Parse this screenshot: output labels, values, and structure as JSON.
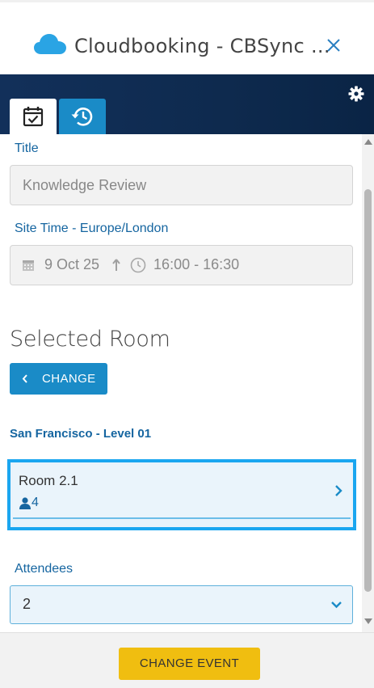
{
  "header": {
    "title": "Cloudbooking - CBSync ...",
    "logo_icon": "cloud-icon",
    "close_icon": "close-icon"
  },
  "toolbar": {
    "settings_icon": "gear-icon",
    "tabs": [
      {
        "icon": "calendar-check-icon",
        "active": true
      },
      {
        "icon": "history-icon",
        "active": false
      }
    ]
  },
  "form": {
    "title_label": "Title",
    "title_value": "Knowledge Review",
    "site_time_label": "Site Time - Europe/London",
    "date_value": "9 Oct 25",
    "time_value": "16:00 - 16:30",
    "selected_room_heading": "Selected Room",
    "change_button": "CHANGE",
    "floor_label": "San Francisco - Level 01",
    "room": {
      "name": "Room 2.1",
      "capacity": "4"
    },
    "attendees_label": "Attendees",
    "attendees_value": "2"
  },
  "footer": {
    "change_event_button": "CHANGE EVENT"
  },
  "colors": {
    "banner": "#0e2a4e",
    "accent_blue": "#1a8bc7",
    "label_blue": "#1565a0",
    "highlight_border": "#1aa6f0",
    "primary_button": "#f0be10"
  }
}
